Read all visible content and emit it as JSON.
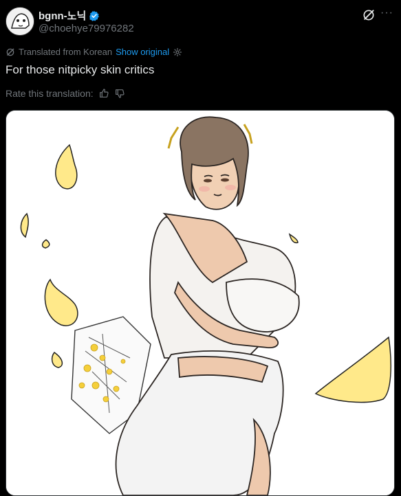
{
  "tweet": {
    "display_name": "bgnn-노닉",
    "handle": "@choehye79976282",
    "translated_label": "Translated from Korean",
    "show_original": "Show original",
    "text": "For those nitpicky skin critics",
    "rate_label": "Rate this translation:",
    "more_label": "···"
  },
  "colors": {
    "accent": "#1d9bf0",
    "muted": "#71767b",
    "background": "#000000"
  },
  "icons": [
    "verified-badge-icon",
    "grok-icon",
    "more-icon",
    "translate-icon",
    "gear-icon",
    "thumbs-up-icon",
    "thumbs-down-icon"
  ]
}
